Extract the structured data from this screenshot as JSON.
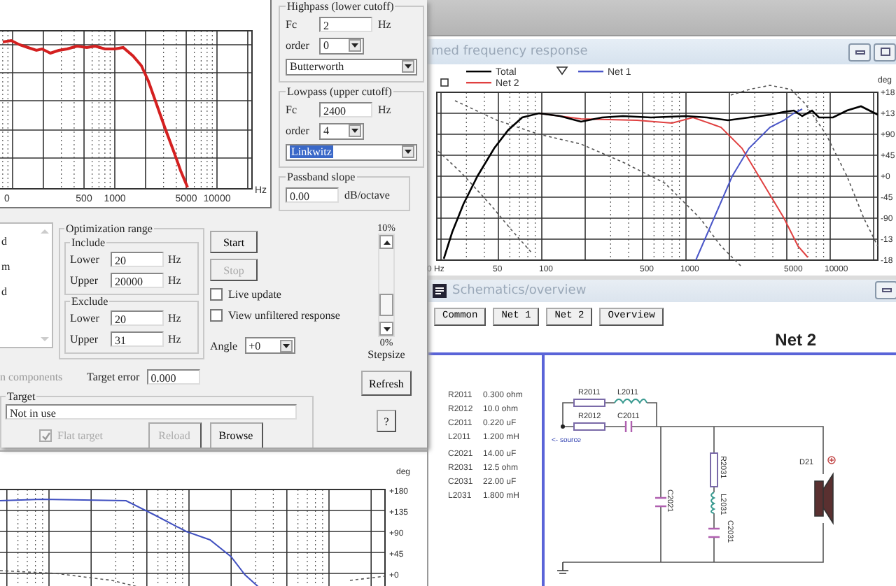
{
  "optimizer": {
    "plot": {
      "x_labels": [
        "0",
        "500",
        "1000",
        "5000",
        "10000"
      ],
      "unit": "Hz"
    },
    "highpass": {
      "title": "Highpass (lower cutoff)",
      "fc_label": "Fc",
      "fc": "2",
      "fc_unit": "Hz",
      "order_label": "order",
      "order": "0",
      "type": "Butterworth",
      "focused": false
    },
    "lowpass": {
      "title": "Lowpass (upper cutoff)",
      "fc_label": "Fc",
      "fc": "2400",
      "fc_unit": "Hz",
      "order_label": "order",
      "order": "4",
      "type": "Linkwitz",
      "focused": true
    },
    "passband": {
      "title": "Passband slope",
      "value": "0.00",
      "unit": "dB/octave"
    },
    "list_items": [
      "d",
      "m",
      "d"
    ],
    "components_label": "n components",
    "range": {
      "title": "Optimization range",
      "include": {
        "title": "Include",
        "lower_label": "Lower",
        "lower": "20",
        "lower_unit": "Hz",
        "upper_label": "Upper",
        "upper": "20000",
        "upper_unit": "Hz"
      },
      "exclude": {
        "title": "Exclude",
        "lower_label": "Lower",
        "lower": "20",
        "lower_unit": "Hz",
        "upper_label": "Upper",
        "upper": "31",
        "upper_unit": "Hz"
      }
    },
    "buttons": [
      {
        "label": "Start",
        "disabled": false
      },
      {
        "label": "Stop",
        "disabled": true
      }
    ],
    "checkboxes": [
      {
        "label": "Live update",
        "checked": false
      },
      {
        "label": "View unfiltered response",
        "checked": false
      }
    ],
    "angle": {
      "label": "Angle",
      "value": "+0"
    },
    "stepsize": {
      "max": "10%",
      "min": "0%",
      "label": "Stepsize",
      "level": 0.15
    },
    "refresh": "Refresh",
    "help": "?",
    "target_error": {
      "label": "Target error",
      "value": "0.000"
    },
    "target": {
      "title": "Target",
      "value": "Not in use",
      "flat": {
        "label": "Flat target",
        "checked": true,
        "disabled": true
      },
      "buttons": [
        {
          "label": "Reload",
          "disabled": true
        },
        {
          "label": "Browse",
          "disabled": false
        }
      ]
    }
  },
  "response_window": {
    "title": "med frequency response",
    "legend": [
      {
        "name": "Total",
        "color": "#000000",
        "kind": "plain"
      },
      {
        "name": "Net 2",
        "color": "#e04040",
        "kind": "square"
      },
      {
        "name": "Net 1",
        "color": "#4a56c8",
        "kind": "triangle"
      }
    ],
    "unit": "deg",
    "y_labels": [
      "+18",
      "+13",
      "+90",
      "+45",
      "+0",
      "-45",
      "-90",
      "-13",
      "-18"
    ],
    "x_labels": [
      "0 Hz",
      "50",
      "100",
      "500",
      "1000",
      "5000",
      "10000"
    ]
  },
  "schematics": {
    "title": "Schematics/overview",
    "tabs": [
      "Common",
      "Net 1",
      "Net 2",
      "Overview"
    ],
    "heading": "Net 2",
    "components": [
      {
        "name": "R2011",
        "value": "0.300 ohm"
      },
      {
        "name": "R2012",
        "value": "10.0 ohm"
      },
      {
        "name": "C2011",
        "value": "0.220 uF"
      },
      {
        "name": "L2011",
        "value": "1.200 mH"
      },
      {
        "name": "C2021",
        "value": "14.00 uF"
      },
      {
        "name": "R2031",
        "value": "12.5 ohm"
      },
      {
        "name": "C2031",
        "value": "22.00 uF"
      },
      {
        "name": "L2031",
        "value": "1.800 mH"
      }
    ],
    "diagram": {
      "r2011": "R2011",
      "l2011": "L2011",
      "r2012": "R2012",
      "c2011": "C2011",
      "source": "<- source",
      "c2021": "C2021",
      "r2031": "R2031",
      "l2031": "L2031",
      "c2031": "C2031",
      "d21": "D21"
    }
  },
  "phase_window": {
    "unit": "deg",
    "y_labels": [
      "+180",
      "+135",
      "+90",
      "+45",
      "+0"
    ]
  }
}
